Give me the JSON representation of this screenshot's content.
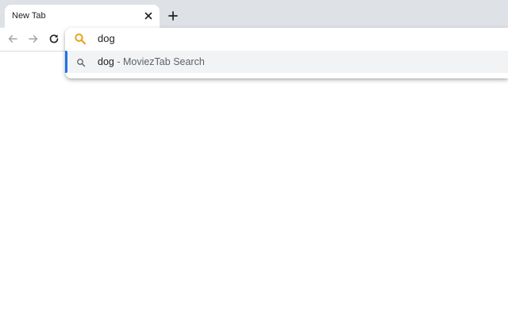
{
  "tab": {
    "title": "New Tab",
    "close_icon": "close-icon"
  },
  "tabstrip": {
    "new_tab_icon": "plus-icon"
  },
  "toolbar": {
    "back_icon": "back-arrow-icon",
    "forward_icon": "forward-arrow-icon",
    "reload_icon": "reload-icon"
  },
  "omnibox": {
    "value": "dog",
    "search_icon": "search-icon",
    "search_icon_color": "#e8a317"
  },
  "suggestions": [
    {
      "query": "dog",
      "separator": " - ",
      "provider": "MoviezTab Search",
      "icon": "search-icon",
      "selected": true
    }
  ],
  "colors": {
    "tabstrip_bg": "#dee1e6",
    "selection_accent": "#1a73e8",
    "selected_row_bg": "#f1f3f4"
  }
}
